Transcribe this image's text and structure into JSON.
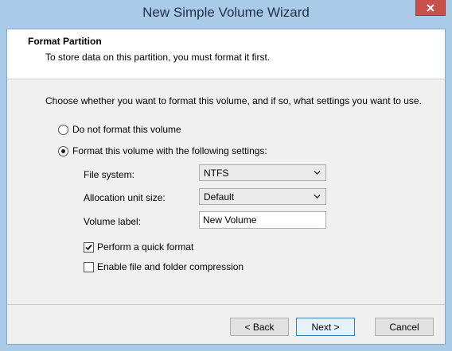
{
  "window": {
    "title": "New Simple Volume Wizard"
  },
  "header": {
    "title": "Format Partition",
    "subtitle": "To store data on this partition, you must format it first."
  },
  "content": {
    "intro": "Choose whether you want to format this volume, and if so, what settings you want to use.",
    "options": {
      "no_format": {
        "label": "Do not format this volume",
        "selected": false
      },
      "format": {
        "label": "Format this volume with the following settings:",
        "selected": true
      }
    },
    "settings": {
      "file_system": {
        "label": "File system:",
        "value": "NTFS"
      },
      "allocation_unit_size": {
        "label": "Allocation unit size:",
        "value": "Default"
      },
      "volume_label": {
        "label": "Volume label:",
        "value": "New Volume"
      }
    },
    "checkboxes": {
      "quick_format": {
        "label": "Perform a quick format",
        "checked": true
      },
      "compression": {
        "label": "Enable file and folder compression",
        "checked": false
      }
    }
  },
  "buttons": {
    "back": "< Back",
    "next": "Next >",
    "cancel": "Cancel"
  },
  "icons": {
    "close": "close-icon",
    "dropdown": "chevron-down-icon",
    "checkmark": "checkmark-icon"
  },
  "colors": {
    "frame": "#a9cbe7",
    "close_button": "#c7504b",
    "dialog_bg": "#f0f0f0",
    "header_bg": "#ffffff"
  }
}
